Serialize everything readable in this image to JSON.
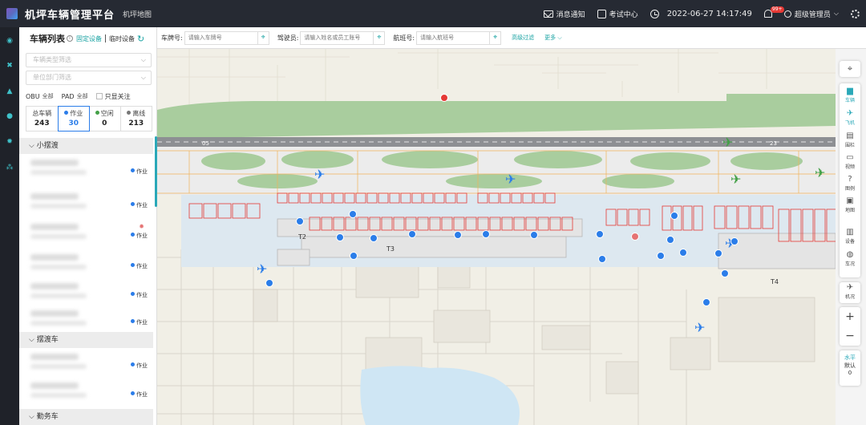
{
  "header": {
    "title": "机坪车辆管理平台",
    "subtitle": "机坪地图",
    "notify": "消息通知",
    "exam": "考试中心",
    "datetime": "2022-06-27 14:17:49",
    "badge": "99+",
    "user": "超级管理员"
  },
  "panel": {
    "title": "车辆列表",
    "fixed": "固定设备",
    "temp": "临时设备",
    "type_ph": "车辆类型筛选",
    "dept_ph": "单位部门筛选",
    "obu_label": "OBU",
    "obu_val": "全部",
    "pad_label": "PAD",
    "pad_val": "全部",
    "only_follow": "只显关注",
    "stats": [
      {
        "label": "总车辆",
        "value": "243"
      },
      {
        "label": "作业",
        "value": "30"
      },
      {
        "label": "空闲",
        "value": "0"
      },
      {
        "label": "离线",
        "value": "213"
      }
    ],
    "stat_colors": [
      "#2b7de9",
      "#43a047",
      "#777777"
    ],
    "groups": [
      {
        "name": "小摆渡"
      },
      {
        "name": "摆渡车"
      },
      {
        "name": "勤务车"
      }
    ],
    "status_working": "作业"
  },
  "search": {
    "plate_label": "车牌号:",
    "plate_ph": "请输入车牌号",
    "driver_label": "驾驶员:",
    "driver_ph": "请输入姓名或员工账号",
    "flight_label": "航班号:",
    "flight_ph": "请输入航班号",
    "advanced": "高级过滤",
    "more": "更多"
  },
  "map": {
    "terminals": [
      "T2",
      "T3",
      "T4"
    ],
    "runway_left": "05",
    "runway_right": "23"
  },
  "tools": {
    "vehicle": "车辆",
    "plane": "飞机",
    "stand": "围栏",
    "video": "视频",
    "legend": "图例",
    "map": "地图",
    "device": "设备",
    "carstatus": "车况",
    "airstatus": "机况",
    "level_label": "水平",
    "level_mode": "默认",
    "level_value": "0"
  }
}
